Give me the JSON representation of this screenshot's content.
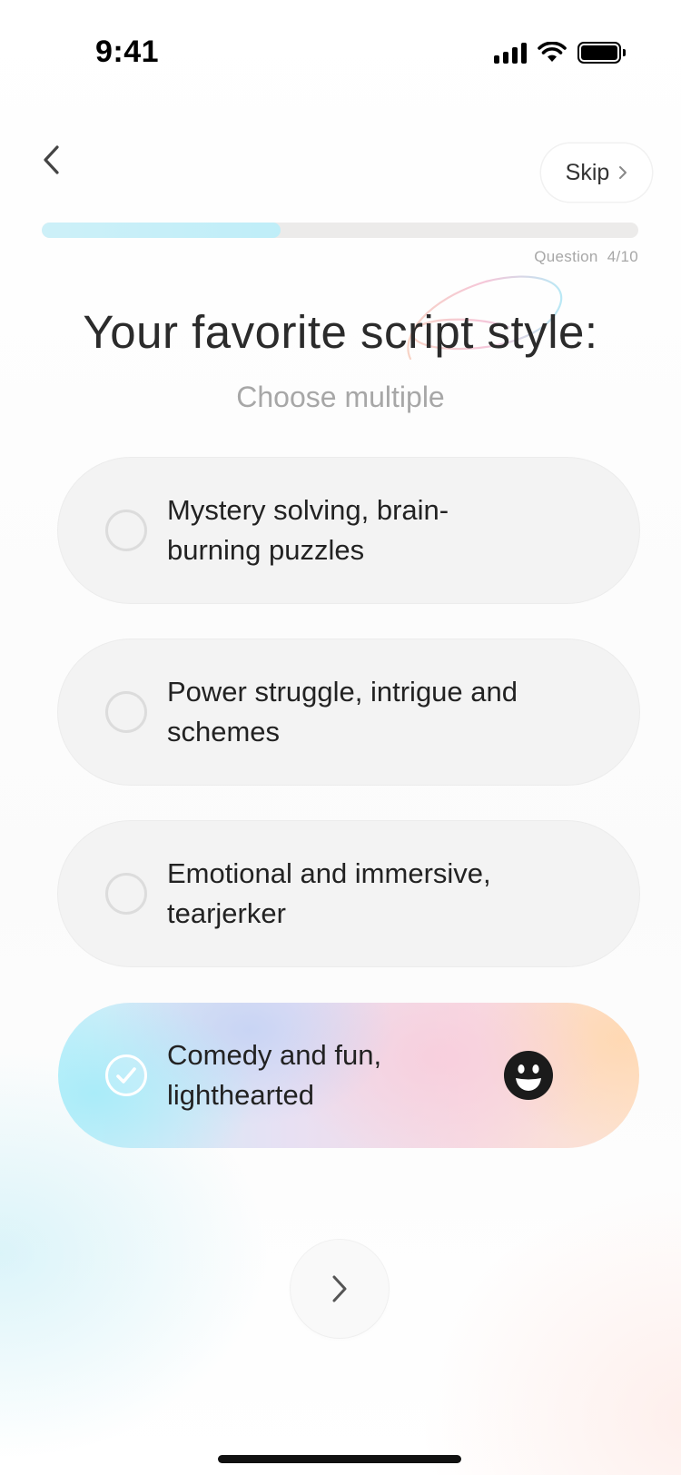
{
  "status_bar": {
    "time": "9:41"
  },
  "header": {
    "skip_label": "Skip"
  },
  "progress": {
    "label": "Question",
    "count": "4/10",
    "current": 4,
    "total": 10,
    "fraction": 0.4
  },
  "question": {
    "title": "Your favorite script style:",
    "subtitle": "Choose multiple"
  },
  "options": [
    {
      "label": "Mystery solving, brain-burning puzzles",
      "selected": false
    },
    {
      "label": "Power struggle, intrigue and schemes",
      "selected": false
    },
    {
      "label": "Emotional and immersive, tearjerker",
      "selected": false
    },
    {
      "label": "Comedy and fun, lighthearted",
      "selected": true,
      "icon": "smiley-icon"
    }
  ],
  "icons": {
    "back": "chevron-left-icon",
    "skip": "chevron-right-icon",
    "next": "chevron-right-icon"
  },
  "colors": {
    "progress_fill": "#c6eff8",
    "progress_track": "#ecebea",
    "option_bg": "#f3f3f3",
    "selected_gradient_start": "#a8ecf9",
    "selected_gradient_end": "#ffd8b2"
  }
}
